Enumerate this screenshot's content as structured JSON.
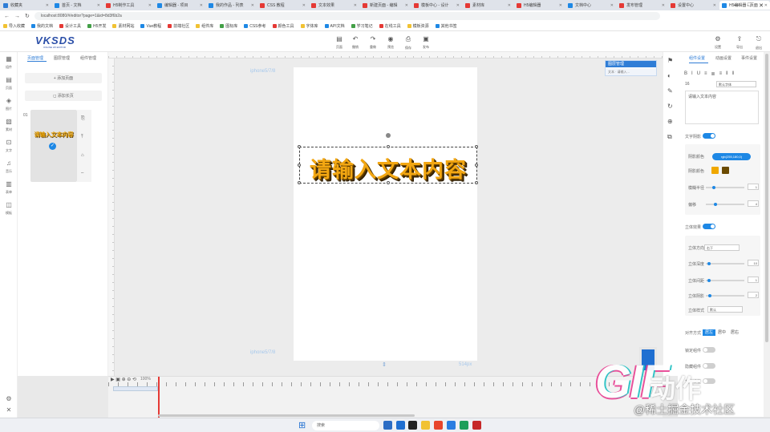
{
  "browser": {
    "tabs": [
      {
        "label": "收藏夹",
        "color": "#2f7dd6"
      },
      {
        "label": "首页 - 文档",
        "color": "#1e88e5"
      },
      {
        "label": "H5制作工具",
        "color": "#e53935"
      },
      {
        "label": "编辑器 - 项目",
        "color": "#1e88e5"
      },
      {
        "label": "我的作品 - 列表",
        "color": "#1e88e5"
      },
      {
        "label": "CSS 教程",
        "color": "#e53935"
      },
      {
        "label": "文本效果",
        "color": "#e53935"
      },
      {
        "label": "新建页面 - 编辑",
        "color": "#e53935"
      },
      {
        "label": "模板中心 - 设计",
        "color": "#e53935"
      },
      {
        "label": "素材库",
        "color": "#e53935"
      },
      {
        "label": "H5编辑器",
        "color": "#e53935"
      },
      {
        "label": "文档中心",
        "color": "#1e88e5"
      },
      {
        "label": "发布管理",
        "color": "#e53935"
      },
      {
        "label": "设置中心",
        "color": "#e53935"
      },
      {
        "label": "H5编辑器 - 页面",
        "color": "#1e88e5",
        "active": true
      }
    ],
    "window_controls": [
      "—",
      "□",
      "✕"
    ],
    "address": {
      "back": "←",
      "forward": "→",
      "reload": "↻",
      "url": "localhost:8080/#/editor?page=1&id=8d3f6b2a"
    },
    "bookmarks": [
      "导入收藏",
      "我的文档",
      "设计工具",
      "H5开发",
      "素材网站",
      "Vue教程",
      "前端社区",
      "组件库",
      "图标库",
      "CSS参考",
      "颜色工具",
      "字体库",
      "API文档",
      "学习笔记",
      "在线工具",
      "模板资源",
      "其他书签"
    ]
  },
  "app": {
    "logo": "VKSDS",
    "logo_sub": "ONLINE H5 EDITOR",
    "toolbar": [
      {
        "icon": "page-icon",
        "glyph": "▤",
        "label": "页面"
      },
      {
        "icon": "undo-icon",
        "glyph": "↶",
        "label": "撤销"
      },
      {
        "icon": "redo-icon",
        "glyph": "↷",
        "label": "重做"
      },
      {
        "icon": "preview-icon",
        "glyph": "◉",
        "label": "预览"
      },
      {
        "icon": "save-icon",
        "glyph": "⎙",
        "label": "保存"
      },
      {
        "icon": "publish-icon",
        "glyph": "▣",
        "label": "发布"
      }
    ],
    "toolbar_right": [
      {
        "icon": "settings-icon",
        "glyph": "⚙",
        "label": "设置"
      },
      {
        "icon": "export-icon",
        "glyph": "⇪",
        "label": "导出"
      },
      {
        "icon": "exit-icon",
        "glyph": "⎋",
        "label": "退出"
      }
    ]
  },
  "left_rail": [
    {
      "glyph": "▦",
      "label": "组件"
    },
    {
      "glyph": "▤",
      "label": "页面"
    },
    {
      "glyph": "◈",
      "label": "图片"
    },
    {
      "glyph": "▧",
      "label": "素材"
    },
    {
      "glyph": "⊡",
      "label": "文字"
    },
    {
      "glyph": "♫",
      "label": "音乐"
    },
    {
      "glyph": "▥",
      "label": "表单"
    },
    {
      "glyph": "◫",
      "label": "模板"
    }
  ],
  "left_rail_bottom": [
    {
      "glyph": "⚙",
      "label": "设置"
    },
    {
      "glyph": "✕",
      "label": "关闭"
    }
  ],
  "left_panel": {
    "tabs": [
      "页面管理",
      "图层管理",
      "组件管理"
    ],
    "add_page": "+ 添加页面",
    "add_long_page": "◻ 添加长页",
    "page_number": "01",
    "thumb_text": "请输入文本内容",
    "thumb_tools": [
      "⎘",
      "⤒",
      "⌂",
      "–"
    ]
  },
  "canvas": {
    "device_label_top": "iphone5/7/8",
    "device_label_bottom": "iphone5/7/8",
    "headline": "请输入文本内容",
    "height_label": "514px",
    "layers_panel": {
      "title": "图层管理",
      "row": "文本 · 请输入..."
    }
  },
  "timeline": {
    "controls": "▶ ▣ ⊕ ⊖ ⟲",
    "zoom": "100%"
  },
  "right_rail": [
    "⚑",
    "◐",
    "✎",
    "↻",
    "⊕",
    "⧉"
  ],
  "props": {
    "tabs": [
      "组件设置",
      "动画设置",
      "事件设置"
    ],
    "format_buttons": [
      "B",
      "I",
      "U",
      "≡",
      "≣",
      "≡",
      "‖",
      "‖"
    ],
    "font_size": "16",
    "font_family": "默认字体",
    "text_value": "请输入文本内容",
    "text_shadow_label": "文字阴影",
    "shadow_color_label": "阴影颜色",
    "shadow_color_value": "rgb(255,180,0)",
    "shadow_swatches": [
      "#f0a800",
      "#6b4a00"
    ],
    "shadow_blur_label": "模糊半径",
    "shadow_blur_value": "1",
    "shadow_offset_label": "偏移",
    "shadow_offset_value": "4",
    "three_d_label": "立体效果",
    "direction_label": "立体方向",
    "direction_value": "右下",
    "depth_label": "立体深度",
    "depth_value": "10",
    "spacing_label": "立体间距",
    "spacing_value": "1",
    "shade_label": "立体阴影",
    "shade_value": "2",
    "style_label": "立体样式",
    "style_value": "默认",
    "align_label": "对齐方式",
    "align_options": [
      "居左",
      "居中",
      "居右"
    ],
    "align_active": "居左",
    "lock_label": "锁定组件",
    "hide_label": "隐藏组件",
    "extra_label": "其他设置"
  },
  "taskbar": {
    "search": "搜索",
    "apps": [
      {
        "color": "#2b6cc4"
      },
      {
        "color": "#1f6fd1"
      },
      {
        "color": "#222222"
      },
      {
        "color": "#f1c232"
      },
      {
        "color": "#e8452c"
      },
      {
        "color": "#2a7de1"
      },
      {
        "color": "#1d9e5b"
      },
      {
        "color": "#c62828"
      }
    ]
  },
  "watermark": {
    "logo": "GIF",
    "sub": "动作",
    "credit": "@稀土掘金技术社区"
  }
}
